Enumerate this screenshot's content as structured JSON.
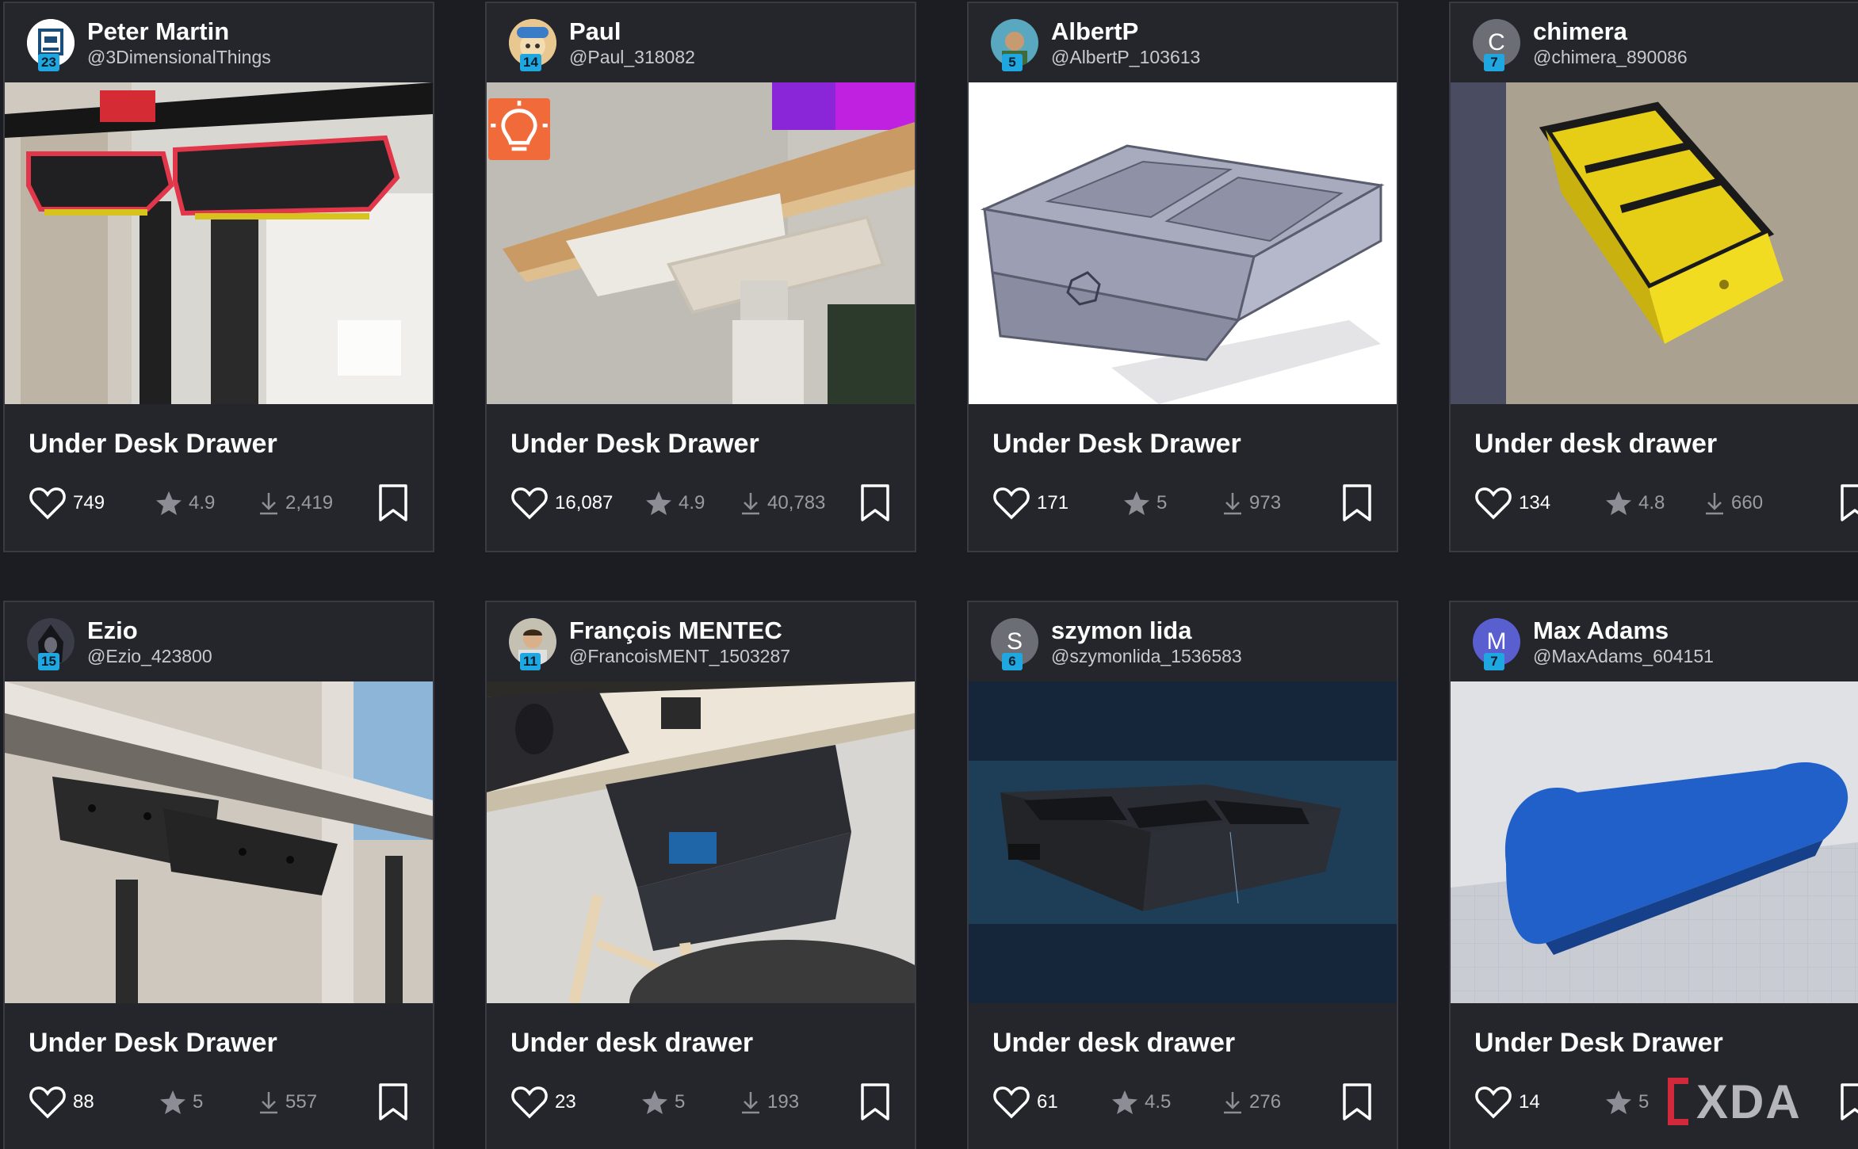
{
  "cards": [
    {
      "user_name": "Peter Martin",
      "handle": "@3DimensionalThings",
      "level": "23",
      "avatar_icon": "printer-avatar-icon",
      "title": "Under Desk Drawer",
      "likes": "749",
      "rating": "4.9",
      "downloads": "2,419",
      "image": "black-drawers-under-desk-photo"
    },
    {
      "user_name": "Paul",
      "handle": "@Paul_318082",
      "level": "14",
      "avatar_icon": "cartoon-avatar-icon",
      "title": "Under Desk Drawer",
      "likes": "16,087",
      "rating": "4.9",
      "downloads": "40,783",
      "image": "white-drawer-under-wood-desk-photo",
      "badge": "lightbulb-icon"
    },
    {
      "user_name": "AlbertP",
      "handle": "@AlbertP_103613",
      "level": "5",
      "avatar_icon": "photo-avatar-icon",
      "title": "Under Desk Drawer",
      "likes": "171",
      "rating": "5",
      "downloads": "973",
      "image": "cad-drawer-render"
    },
    {
      "user_name": "chimera",
      "handle": "@chimera_890086",
      "level": "7",
      "avatar_letter": "C",
      "title": "Under desk drawer",
      "likes": "134",
      "rating": "4.8",
      "downloads": "660",
      "image": "yellow-drawer-on-carpet-photo"
    },
    {
      "user_name": "Ezio",
      "handle": "@Ezio_423800",
      "level": "15",
      "avatar_icon": "hooded-avatar-icon",
      "title": "Under Desk Drawer",
      "likes": "88",
      "rating": "5",
      "downloads": "557",
      "image": "dark-drawers-under-desk-photo"
    },
    {
      "user_name": "François MENTEC",
      "handle": "@FrancoisMENT_1503287",
      "level": "11",
      "avatar_icon": "photo-avatar-icon",
      "title": "Under desk drawer",
      "likes": "23",
      "rating": "5",
      "downloads": "193",
      "image": "open-black-drawer-under-desk-photo"
    },
    {
      "user_name": "szymon lida",
      "handle": "@szymonlida_1536583",
      "level": "6",
      "avatar_letter": "S",
      "title": "Under desk drawer",
      "likes": "61",
      "rating": "4.5",
      "downloads": "276",
      "image": "dark-render-drawer"
    },
    {
      "user_name": "Max Adams",
      "handle": "@MaxAdams_604151",
      "level": "7",
      "avatar_letter": "M",
      "title": "Under Desk Drawer",
      "likes": "14",
      "rating": "5",
      "downloads": "",
      "image": "blue-rounded-part-render"
    }
  ],
  "watermark": {
    "text": "XDA"
  },
  "colors": {
    "background": "#1c1d22",
    "card": "#25262c",
    "level_badge": "#1ea7e1",
    "idea_badge": "#f06a3a"
  }
}
